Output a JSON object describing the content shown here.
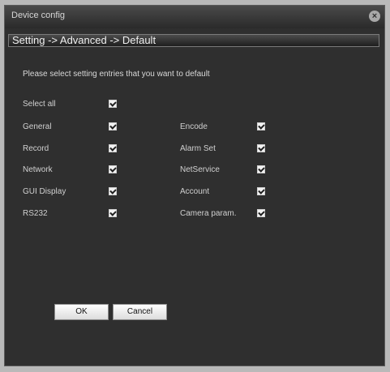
{
  "window": {
    "title": "Device config"
  },
  "breadcrumb": "Setting -> Advanced -> Default",
  "hint": "Please select setting entries that you want to default",
  "select_all": {
    "label": "Select all",
    "checked": true
  },
  "left_options": [
    {
      "label": "General",
      "checked": true
    },
    {
      "label": "Record",
      "checked": true
    },
    {
      "label": "Network",
      "checked": true
    },
    {
      "label": "GUI Display",
      "checked": true
    },
    {
      "label": "RS232",
      "checked": true
    }
  ],
  "right_options": [
    {
      "label": "Encode",
      "checked": true
    },
    {
      "label": "Alarm Set",
      "checked": true
    },
    {
      "label": "NetService",
      "checked": true
    },
    {
      "label": "Account",
      "checked": true
    },
    {
      "label": "Camera param.",
      "checked": true
    }
  ],
  "buttons": {
    "ok": "OK",
    "cancel": "Cancel"
  }
}
